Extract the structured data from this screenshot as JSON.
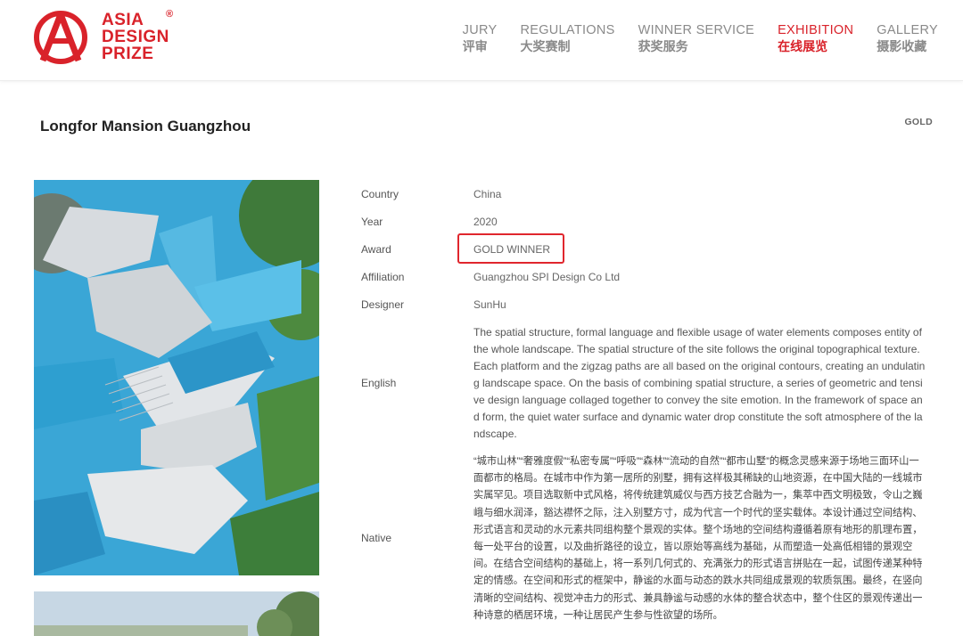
{
  "logo": {
    "lines": [
      "ASIA",
      "DESIGN",
      "PRIZE"
    ],
    "registered": "®"
  },
  "nav": [
    {
      "en": "JURY",
      "zh": "评审",
      "active": false
    },
    {
      "en": "REGULATIONS",
      "zh": "大奖赛制",
      "active": false
    },
    {
      "en": "WINNER SERVICE",
      "zh": "获奖服务",
      "active": false
    },
    {
      "en": "EXHIBITION",
      "zh": "在线展览",
      "active": true
    },
    {
      "en": "GALLERY",
      "zh": "摄影收藏",
      "active": false
    }
  ],
  "project": {
    "title": "Longfor Mansion Guangzhou",
    "award_tag": "GOLD"
  },
  "details": [
    {
      "key": "Country",
      "value": "China"
    },
    {
      "key": "Year",
      "value": "2020"
    },
    {
      "key": "Award",
      "value": "GOLD WINNER"
    },
    {
      "key": "Affiliation",
      "value": "Guangzhou SPI Design Co Ltd"
    },
    {
      "key": "Designer",
      "value": "SunHu"
    }
  ],
  "description": {
    "english_label": "English",
    "english_text": "The spatial structure, formal language and flexible usage of water elements composes entity of the whole landscape. The spatial structure of the site follows the original topographical texture. Each platform and the zigzag paths are all based on the original contours, creating an undulating landscape space. On the basis of combining spatial structure, a series of geometric and tensive design language collaged together to convey the site emotion. In the framework of space and form, the quiet water surface and dynamic water drop constitute the soft atmosphere of the landscape.",
    "native_label": "Native",
    "native_text": "“城市山林”“奢雅度假”“私密专属”“呼吸”“森林”“流动的自然”“都市山墅”的概念灵感来源于场地三面环山一面都市的格局。在城市中作为第一居所的别墅，拥有这样极其稀缺的山地资源，在中国大陆的一线城市实属罕见。项目选取新中式风格，将传统建筑威仪与西方技艺合融为一，集萃中西文明极致，令山之巍峨与细水润泽，豁达襟怀之际，注入别墅方寸，成为代言一个时代的坚实载体。本设计通过空间结构、形式语言和灵动的水元素共同组构整个景观的实体。整个场地的空间结构遵循着原有地形的肌理布置，每一处平台的设置，以及曲折路径的设立，皆以原始等高线为基础，从而塑造一处高低相错的景观空间。在结合空间结构的基础上，将一系列几何式的、充满张力的形式语言拼贴在一起，试图传递某种特定的情感。在空间和形式的框架中，静谧的水面与动态的跌水共同组成景观的软质氛围。最终，在竖向清晰的空间结构、视觉冲击力的形式、兼具静谧与动感的水体的整合状态中，整个住区的景观传递出一种诗意的栖居环境，一种让居民产生参与性欲望的场所。"
  },
  "colors": {
    "brand_red": "#d9222a",
    "water_blue": "#2e9fd0"
  }
}
